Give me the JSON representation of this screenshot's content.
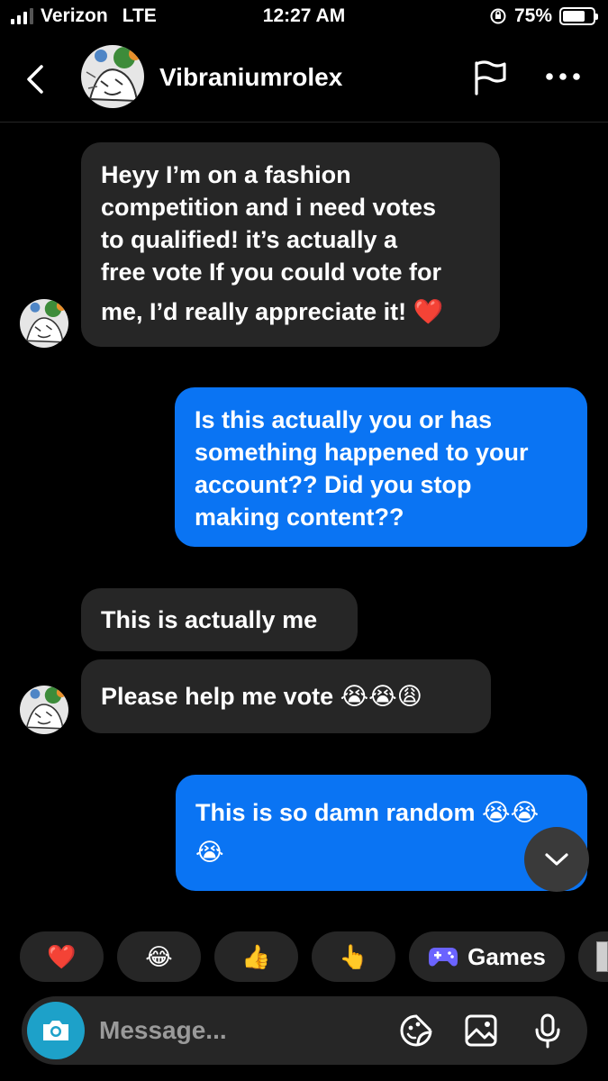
{
  "status": {
    "carrier": "Verizon",
    "network": "LTE",
    "time": "12:27 AM",
    "battery": "75%",
    "battery_level": 0.75,
    "signal_bars": 3
  },
  "header": {
    "username": "Vibraniumrolex"
  },
  "messages": [
    {
      "direction": "incoming",
      "text": [
        "Heyy I’m on a fashion",
        "competition and i need votes",
        "to qualified! it’s actually a",
        "free vote If you could vote for",
        "me, I’d really appreciate it! ❤️"
      ]
    },
    {
      "direction": "outgoing",
      "text": [
        "Is this actually you or has",
        "something happened to your",
        "account?? Did you stop",
        "making content??"
      ]
    },
    {
      "direction": "incoming",
      "text": [
        "This is actually me"
      ]
    },
    {
      "direction": "incoming",
      "text": [
        "Please help me vote 😭😭😩"
      ]
    },
    {
      "direction": "outgoing",
      "text": [
        "This is so damn random 😭😭",
        "😭"
      ]
    }
  ],
  "quick_reactions": [
    {
      "emoji": "❤️"
    },
    {
      "emoji": "😂"
    },
    {
      "emoji": "👍"
    },
    {
      "emoji": "👆"
    },
    {
      "label": "Games",
      "icon": "gamepad-icon"
    }
  ],
  "composer": {
    "placeholder": "Message..."
  },
  "colors": {
    "background": "#000000",
    "incoming_bubble": "#262626",
    "outgoing_bubble": "#0a74f3",
    "camera_button": "#1da1c9",
    "games_icon": "#6b63ff"
  }
}
